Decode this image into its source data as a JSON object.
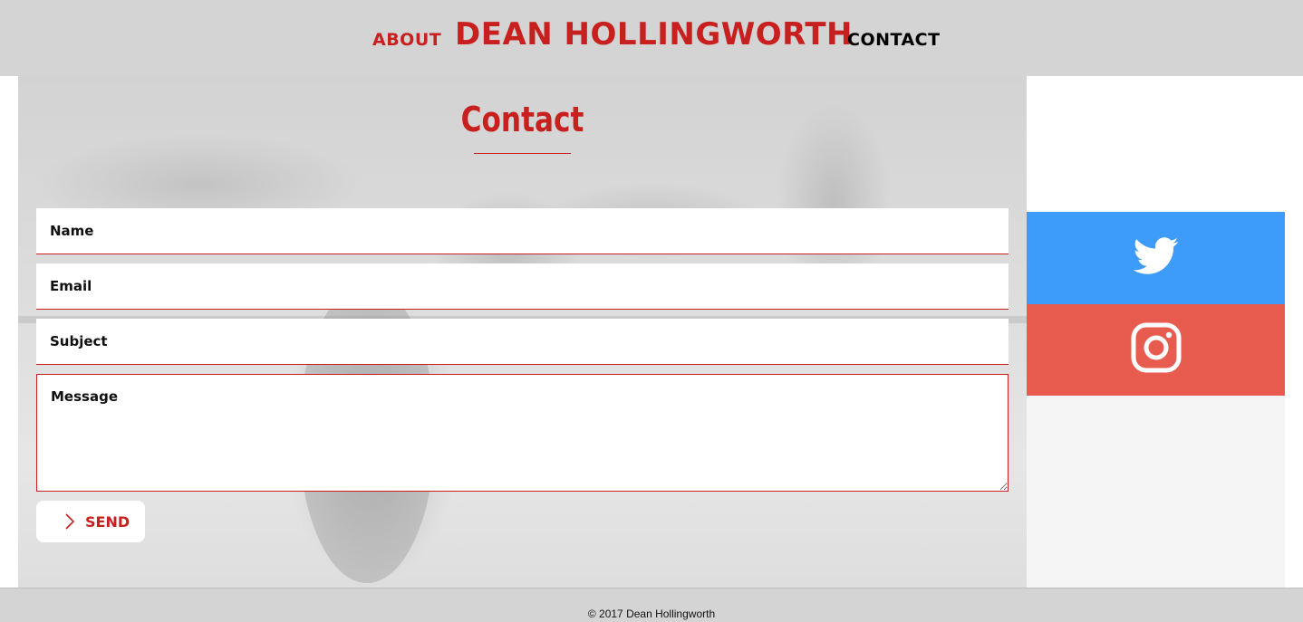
{
  "header": {
    "nav_about": "ABOUT",
    "brand": "DEAN HOLLINGWORTH",
    "nav_contact": "CONTACT"
  },
  "contact": {
    "title": "Contact",
    "form": {
      "name_placeholder": "Name",
      "email_placeholder": "Email",
      "subject_placeholder": "Subject",
      "message_placeholder": "Message",
      "send_label": "SEND"
    }
  },
  "social": {
    "twitter": {
      "icon": "twitter-icon",
      "color": "#3d9bfa"
    },
    "instagram": {
      "icon": "instagram-icon",
      "color": "#e85b4f"
    }
  },
  "footer": {
    "copyright": "© 2017 Dean Hollingworth"
  },
  "colors": {
    "accent": "#c8201f",
    "header_bg": "#d4d4d4"
  }
}
